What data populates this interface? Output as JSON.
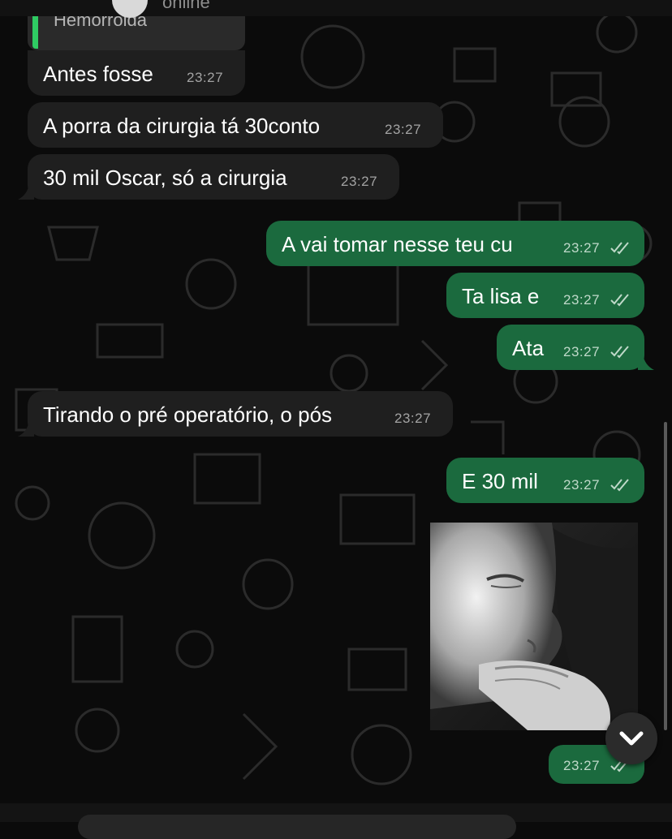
{
  "header": {
    "status": "online"
  },
  "reply_quote": {
    "text": "Hemorroida"
  },
  "messages": [
    {
      "text": "Antes fosse",
      "time": "23:27",
      "direction": "in"
    },
    {
      "text": "A porra da cirurgia tá 30conto",
      "time": "23:27",
      "direction": "in"
    },
    {
      "text": "30 mil Oscar, só a cirurgia",
      "time": "23:27",
      "direction": "in"
    },
    {
      "text": "A vai tomar nesse teu cu",
      "time": "23:27",
      "direction": "out"
    },
    {
      "text": "Ta lisa e",
      "time": "23:27",
      "direction": "out"
    },
    {
      "text": "Ata",
      "time": "23:27",
      "direction": "out"
    },
    {
      "text": "Tirando o pré operatório, o pós",
      "time": "23:27",
      "direction": "in"
    },
    {
      "text": "E 30 mil",
      "time": "23:27",
      "direction": "out"
    }
  ],
  "image_message": {
    "time": "23:27",
    "image_icon": "baby-photo"
  },
  "icons": {
    "read_receipt": "double-check-icon",
    "scroll_down": "chevron-down-icon"
  },
  "colors": {
    "background": "#0b0b0b",
    "incoming_bubble": "#1f1f1f",
    "outgoing_bubble": "#1b6a3e",
    "read_tick": "#bfd9c9",
    "reply_bar": "#2fcb63"
  }
}
